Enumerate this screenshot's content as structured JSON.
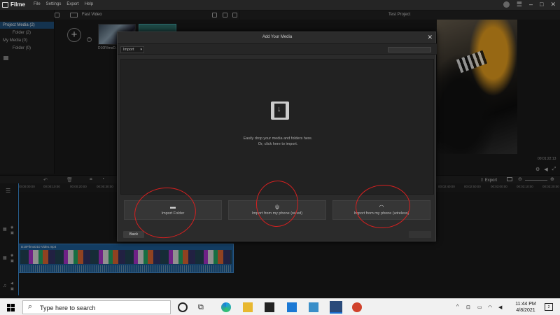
{
  "app": {
    "name": "Filme",
    "menu": [
      "File",
      "Settings",
      "Export",
      "Help"
    ]
  },
  "media_toolbar": {
    "title": "Fast Video"
  },
  "tree": {
    "items": [
      {
        "label": "Project Media (2)"
      },
      {
        "label": "Folder (2)"
      },
      {
        "label": "My Media (0)"
      },
      {
        "label": "Folder (0)"
      }
    ]
  },
  "media_bin": {
    "thumb_label": "D10FilmoD..."
  },
  "preview": {
    "title": "Test Project",
    "timecode": "00:01:22:13"
  },
  "timeline": {
    "export_label": "Export",
    "ticks": [
      "00:00:00:00",
      "00:00:10:00",
      "00:00:20:00",
      "00:00:30:00",
      "00:02:40:00",
      "00:02:50:00",
      "00:03:00:00",
      "00:03:10:00",
      "00:03:20:00"
    ],
    "clip_label": "D10FilmoD10 Video.mp4"
  },
  "modal": {
    "title": "Add Your Media",
    "import_dropdown": "Import",
    "drop_line1": "Easily drop your media and folders here.",
    "drop_line2": "Or, click here to import.",
    "options": [
      {
        "label": "Import Folder",
        "icon": "folder-icon"
      },
      {
        "label": "Import from my phone (wired)",
        "icon": "usb-icon"
      },
      {
        "label": "Import from my phone (wireless)",
        "icon": "wifi-icon"
      }
    ],
    "back_label": "Back"
  },
  "annotation_color": "#d62020",
  "taskbar": {
    "search_placeholder": "Type here to search",
    "time": "11:44 PM",
    "date": "4/8/2021",
    "notification_count": "2"
  }
}
